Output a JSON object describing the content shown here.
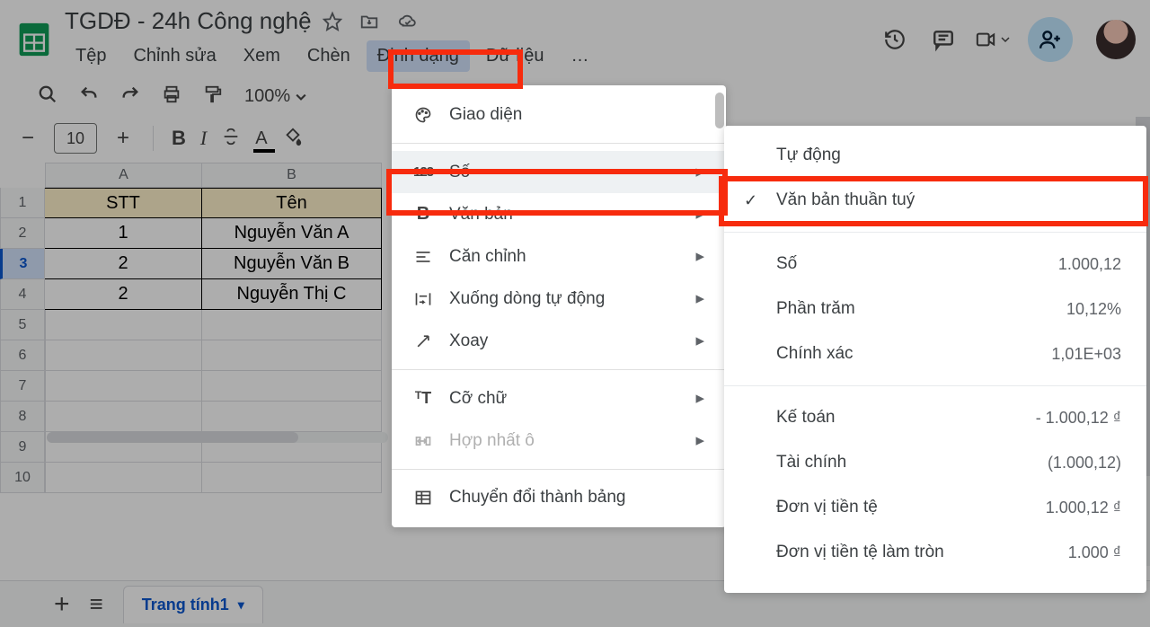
{
  "doc_title": "TGDĐ - 24h Công nghệ",
  "menubar": [
    "Tệp",
    "Chỉnh sửa",
    "Xem",
    "Chèn",
    "Định dạng",
    "Dữ liệu",
    "…"
  ],
  "active_menu_index": 4,
  "toolbar": {
    "zoom": "100%",
    "font_size": "10"
  },
  "sheet": {
    "columns": [
      "A",
      "B"
    ],
    "header_row": [
      "STT",
      "Tên"
    ],
    "rows": [
      {
        "num": "1",
        "A": "STT",
        "B": "Tên",
        "header": true
      },
      {
        "num": "2",
        "A": "1",
        "B": "Nguyễn Văn A"
      },
      {
        "num": "3",
        "A": "2",
        "B": "Nguyễn Văn B",
        "selected": true
      },
      {
        "num": "4",
        "A": "2",
        "B": "Nguyễn Thị C"
      }
    ],
    "empty_rows": [
      "5",
      "6",
      "7",
      "8",
      "9",
      "10"
    ]
  },
  "bottom": {
    "sheet_tab": "Trang tính1"
  },
  "format_menu": [
    {
      "icon": "palette",
      "label": "Giao diện"
    },
    {
      "separator": true
    },
    {
      "icon": "number",
      "label": "Số",
      "hover": true,
      "arrow": true
    },
    {
      "icon": "bold",
      "label": "Văn bản",
      "arrow": true
    },
    {
      "icon": "align",
      "label": "Căn chỉnh",
      "arrow": true
    },
    {
      "icon": "wrap",
      "label": "Xuống dòng tự động",
      "arrow": true
    },
    {
      "icon": "rotate",
      "label": "Xoay",
      "arrow": true
    },
    {
      "separator": true
    },
    {
      "icon": "textsize",
      "label": "Cỡ chữ",
      "arrow": true
    },
    {
      "icon": "merge",
      "label": "Hợp nhất ô",
      "disabled": true,
      "arrow": true
    },
    {
      "separator": true
    },
    {
      "icon": "table",
      "label": "Chuyển đổi thành bảng"
    }
  ],
  "number_submenu": [
    {
      "label": "Tự động"
    },
    {
      "label": "Văn bản thuần tuý",
      "checked": true
    },
    {
      "separator": true
    },
    {
      "label": "Số",
      "value": "1.000,12"
    },
    {
      "label": "Phần trăm",
      "value": "10,12%"
    },
    {
      "label": "Chính xác",
      "value": "1,01E+03"
    },
    {
      "separator": true
    },
    {
      "label": "Kế toán",
      "value": "- 1.000,12 ₫"
    },
    {
      "label": "Tài chính",
      "value": "(1.000,12)"
    },
    {
      "label": "Đơn vị tiền tệ",
      "value": "1.000,12 ₫"
    },
    {
      "label": "Đơn vị tiền tệ làm tròn",
      "value": "1.000 ₫"
    }
  ]
}
